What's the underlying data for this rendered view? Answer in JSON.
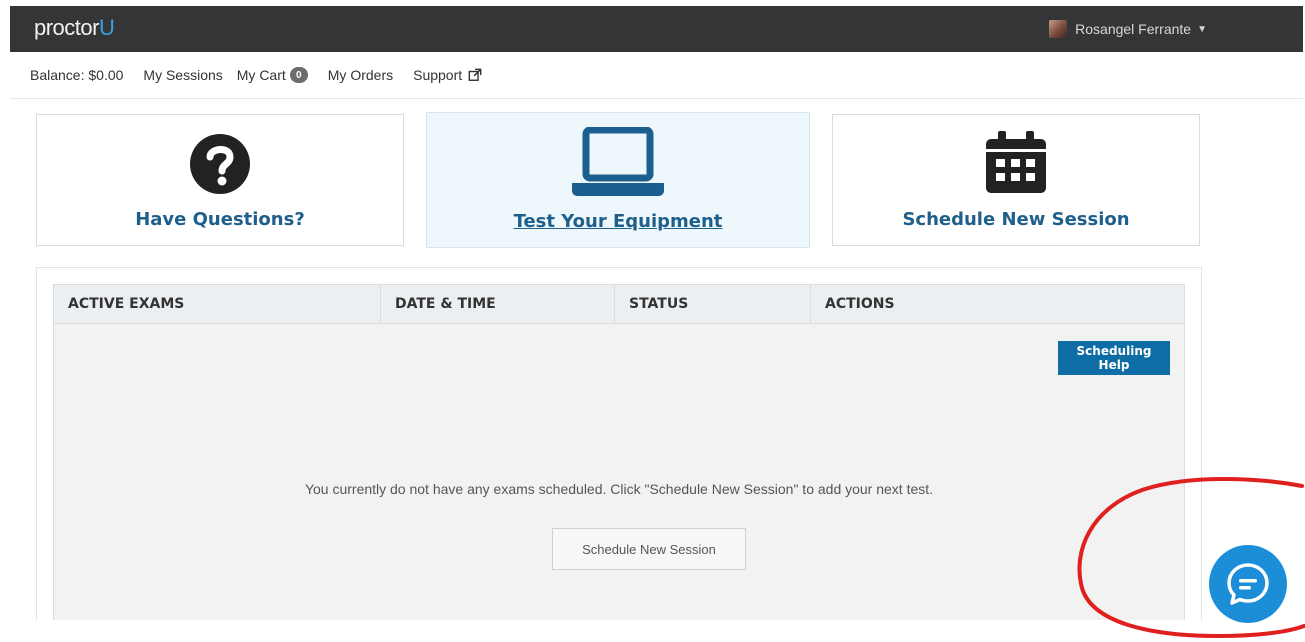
{
  "header": {
    "logo_text": "proctor",
    "logo_accent": "U",
    "user_name": "Rosangel Ferrante"
  },
  "nav": {
    "balance": "Balance: $0.00",
    "my_sessions": "My Sessions",
    "my_cart": "My Cart",
    "cart_count": "0",
    "my_orders": "My Orders",
    "support": "Support"
  },
  "cards": {
    "questions": "Have Questions?",
    "equipment": "Test Your Equipment",
    "schedule": "Schedule New Session"
  },
  "table": {
    "headers": [
      "ACTIVE EXAMS",
      "DATE & TIME",
      "STATUS",
      "ACTIONS"
    ],
    "help_button": "Scheduling Help",
    "empty_message": "You currently do not have any exams scheduled. Click \"Schedule New Session\" to add your next test.",
    "schedule_button": "Schedule New Session"
  },
  "colors": {
    "topbar": "#333537",
    "accent_blue": "#0f6da5",
    "card_label": "#1f5f8b",
    "chat_button": "#1c8ed8",
    "annotation_red": "#e0201f"
  },
  "icons": {
    "questions": "question-circle-icon",
    "equipment": "laptop-icon",
    "schedule": "calendar-icon",
    "support": "external-link-icon",
    "chat": "chat-bubble-icon"
  }
}
